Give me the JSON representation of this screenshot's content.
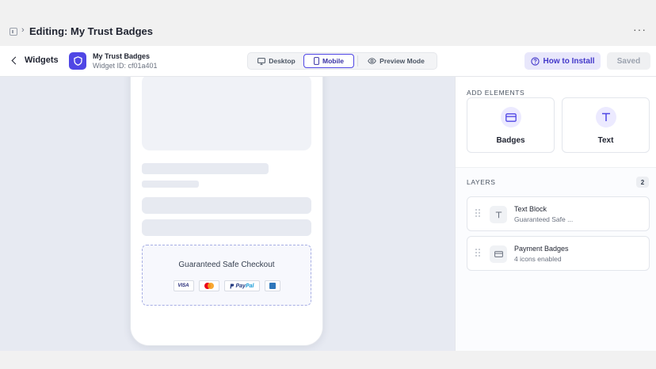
{
  "titlebar": {
    "title": "Editing: My Trust Badges",
    "more_label": "···"
  },
  "header": {
    "back_label": "Widgets",
    "widget_name": "My Trust Badges",
    "widget_id": "Widget ID: cf01a401",
    "view_modes": [
      {
        "label": "Desktop",
        "icon": "monitor-icon",
        "active": false
      },
      {
        "label": "Mobile",
        "icon": "phone-icon",
        "active": true
      },
      {
        "label": "Preview Mode",
        "icon": "eye-icon",
        "active": false
      }
    ],
    "how_to_install_label": "How to Install",
    "saved_label": "Saved",
    "accent_color": "#4f46e5"
  },
  "preview": {
    "trust_title": "Guaranteed Safe Checkout",
    "badges": [
      "VISA",
      "Mastercard",
      "PayPal",
      "Amex"
    ],
    "paypal_pay": "Pay",
    "paypal_pal": "Pal",
    "visa_text": "VISA"
  },
  "panel": {
    "add_elements_heading": "ADD ELEMENTS",
    "elements": [
      {
        "label": "Badges",
        "icon": "card-icon"
      },
      {
        "label": "Text",
        "icon": "text-icon"
      }
    ],
    "layers_heading": "LAYERS",
    "layers_count": "2",
    "layers": [
      {
        "name": "Text Block",
        "subtitle": "Guaranteed Safe ...",
        "icon": "text-icon"
      },
      {
        "name": "Payment Badges",
        "subtitle": "4 icons enabled",
        "icon": "card-icon"
      }
    ]
  }
}
